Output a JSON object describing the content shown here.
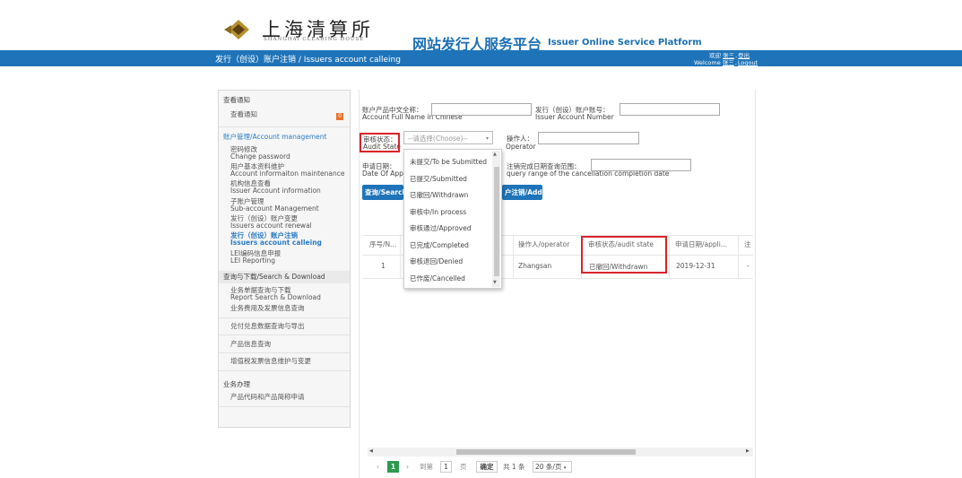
{
  "header": {
    "logo_cn": "上海清算所",
    "logo_en": "SHANGHAI CLEARING HOUSE",
    "platform_cn": "网站发行人服务平台",
    "platform_en": "Issuer Online Service Platform",
    "breadcrumb": "发行（创设）账户注销 / Issuers account calleing",
    "welcome_cn": "欢迎",
    "user_cn": "张三",
    "logout_cn": "登出",
    "welcome_en": "Welcome",
    "user_en": "张三",
    "logout_en": "Logout"
  },
  "sidebar": {
    "notice_header": "查看通知",
    "notice_item": "查看通知",
    "notice_badge": "0",
    "account_header": "账户管理/Account management",
    "password_cn": "密码修改",
    "password_en": "Change password",
    "userinfo_cn": "用户基本资料维护",
    "userinfo_en": "Account informaiton maintenance",
    "issuer_cn": "机构信息查看",
    "issuer_en": "Issuer Account information",
    "subaccount_cn": "子账户管理",
    "subaccount_en": "Sub-account Management",
    "renewal_cn": "发行（创设）账户变更",
    "renewal_en": "Issuers account renewal",
    "calleing_cn": "发行（创设）账户注销",
    "calleing_en": "Issuers account calleing",
    "lei_cn": "LEI编码信息申报",
    "lei_en": "LEI Reporting",
    "search_header": "查询与下载/Search & Download",
    "report_cn": "业务单据查询与下载",
    "report_en": "Report Search & Download",
    "fee_cn": "业务费用及发票信息查询",
    "cashflow_cn": "兑付兑息数据查询与导出",
    "product_cn": "产品信息查询",
    "vat_cn": "增值税发票信息维护与变更",
    "business_header": "业务办理",
    "product_code_cn": "产品代码和产品简称申请"
  },
  "form": {
    "name_cn": "账户产品中文全称：",
    "name_en": "Account Full Name in Chinese",
    "account_no_cn": "发行（创设）账户账号：",
    "account_no_en": "Issuer Account Number",
    "audit_cn": "审核状态：",
    "audit_en": "Audit State",
    "select_placeholder": "--请选择(Choose)--",
    "operator_cn": "操作人：",
    "operator_en": "Operator",
    "date_cn": "申请日期：",
    "date_en": "Date Of App",
    "range_cn": "注销完成日期查询范围：",
    "range_en": "query range of the cancellation completion date",
    "search_button": "查询/Search",
    "add_button": "户注销/Add"
  },
  "dropdown": {
    "options": [
      "未提交/To be Submitted",
      "已提交/Submitted",
      "已撤回/Withdrawn",
      "审核中/In process",
      "审核通过/Approved",
      "已完成/Completed",
      "审核退回/Denied",
      "已作废/Cancelled"
    ]
  },
  "table": {
    "headers": [
      "序号/N...",
      "操作人/operator",
      "审核状态/audit state",
      "申请日期/appli...",
      "注"
    ],
    "rows": [
      {
        "no": "1",
        "operator": "Zhangsan",
        "state": "已撤回/Withdrawn",
        "date": "2019-12-31",
        "extra": "-"
      }
    ]
  },
  "pagination": {
    "current": "1",
    "goto_label": "到第",
    "page_input": "1",
    "page_unit": "页",
    "confirm": "确定",
    "total": "共 1 条",
    "per_page": "20 条/页"
  }
}
